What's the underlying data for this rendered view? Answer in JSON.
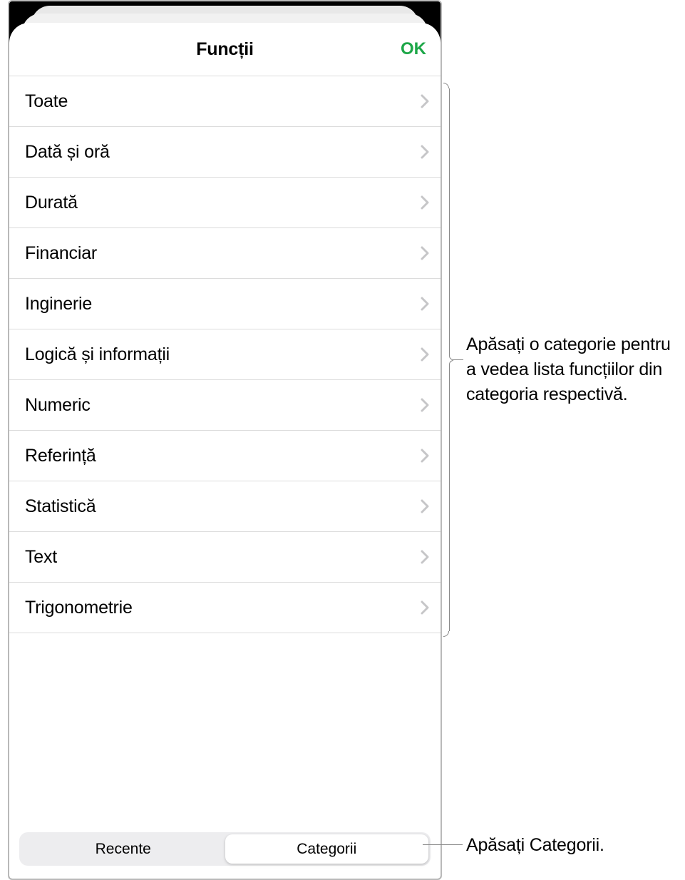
{
  "header": {
    "title": "Funcții",
    "ok_label": "OK"
  },
  "categories": [
    {
      "label": "Toate"
    },
    {
      "label": "Dată și oră"
    },
    {
      "label": "Durată"
    },
    {
      "label": "Financiar"
    },
    {
      "label": "Inginerie"
    },
    {
      "label": "Logică și informații"
    },
    {
      "label": "Numeric"
    },
    {
      "label": "Referință"
    },
    {
      "label": "Statistică"
    },
    {
      "label": "Text"
    },
    {
      "label": "Trigonometrie"
    }
  ],
  "segmented": {
    "recent_label": "Recente",
    "categories_label": "Categorii"
  },
  "callouts": {
    "list": "Apăsați o categorie pentru a vedea lista funcțiilor din categoria respectivă.",
    "segmented": "Apăsați Categorii."
  }
}
